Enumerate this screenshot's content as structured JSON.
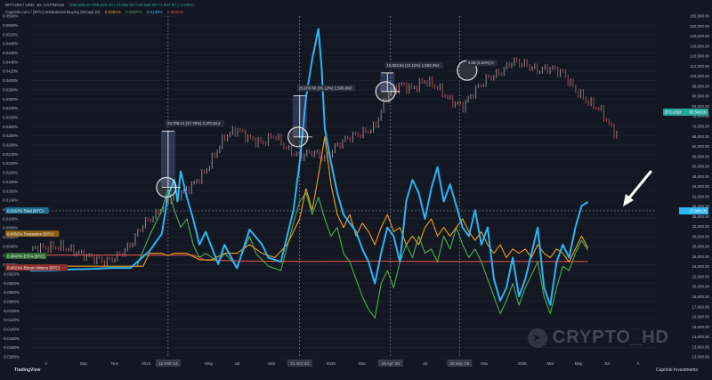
{
  "header": {
    "line1": "BITCOIN / USD, 1D, CAPRIOLE",
    "ohlc": "O95,568.00  H95,620.00  L78,052.00  C80,568.00  +1,007.57 (+2.58%)",
    "line2": "Capriole.com / (BTC) Institutional Buying (MCap) (0)",
    "ind_values": [
      "0.0052%",
      "0.0047%",
      "0.0138%",
      "0.0021%"
    ]
  },
  "watermark": "CRYPTO_HD",
  "branding": {
    "tradingview": "TradingView",
    "capriole": "Capriole Investments"
  },
  "colors": {
    "background": "#131722",
    "price_up": "#8a8c90",
    "price_down": "#a64a4f",
    "total": "#29b6f6",
    "treasuries": "#f2a01b",
    "etfs": "#4caf50",
    "miners": "#ef5350",
    "annotation": "#6f8bd6"
  },
  "chart_data": {
    "type": "line",
    "title": "",
    "x_ticks": [
      "2",
      "Sep",
      "Nov",
      "2024",
      "12 Feb '24",
      "May",
      "Jul",
      "Sep",
      "21 Oct '24",
      "2025",
      "Mar",
      "26 Apr '25",
      "Jul",
      "30 Sep '25",
      "Nov",
      "2026",
      "Mar",
      "May",
      "Jul",
      "A"
    ],
    "x_tick_frac": [
      0.025,
      0.085,
      0.135,
      0.185,
      0.22,
      0.285,
      0.33,
      0.385,
      0.43,
      0.48,
      0.53,
      0.575,
      0.63,
      0.685,
      0.725,
      0.785,
      0.83,
      0.875,
      0.92,
      0.97
    ],
    "left_axis": [
      "0.0590%",
      "0.0560%",
      "0.0520%",
      "0.0480%",
      "0.0460%",
      "0.0440%",
      "0.0420%",
      "0.0400%",
      "0.0380%",
      "0.0360%",
      "0.0340%",
      "0.0320%",
      "0.0300%",
      "0.0280%",
      "0.0260%",
      "0.0240%",
      "0.0220%",
      "0.0200%",
      "0.0180%",
      "0.0160%",
      "0.0140%",
      "0.0120%",
      "0.0100%",
      "0.0080%",
      "0.0060%",
      "0.0040%",
      "0.0020%",
      "0.0000%",
      "-0.0020%",
      "-0.0040%",
      "-0.0060%",
      "-0.0080%",
      "-0.0100%",
      "-0.0120%",
      "-0.0140%",
      "-0.0160%",
      "-0.0180%",
      "-0.0200%"
    ],
    "left_range": [
      -0.02,
      0.059
    ],
    "right_axis": [
      "165,000.00",
      "150,000.00",
      "140,000.00",
      "130,000.00",
      "120,000.00",
      "112,000.00",
      "104,000.00",
      "98,000.00",
      "90,000.00",
      "84,000.00",
      "76,000.00",
      "72,000.00",
      "68,000.00",
      "62,000.00",
      "56,000.00",
      "52,000.00",
      "48,000.00",
      "44,000.00",
      "41,000.00",
      "38,000.00",
      "35,000.00",
      "32,000.00",
      "30,000.00",
      "28,000.00",
      "26,000.00",
      "24,000.00",
      "22,000.00",
      "20,000.00",
      "18,600.00",
      "17,600.00",
      "16,600.00",
      "15,600.00",
      "14,800.00",
      "13,800.00",
      "13,000.00"
    ],
    "price_scale": "log",
    "price_range": [
      13000,
      165000
    ],
    "price": [
      [
        0.0,
        29000
      ],
      [
        0.02,
        29300
      ],
      [
        0.05,
        29600
      ],
      [
        0.08,
        28000
      ],
      [
        0.1,
        27200
      ],
      [
        0.12,
        26400
      ],
      [
        0.14,
        27500
      ],
      [
        0.16,
        30000
      ],
      [
        0.18,
        35000
      ],
      [
        0.2,
        37500
      ],
      [
        0.22,
        42000
      ],
      [
        0.24,
        44000
      ],
      [
        0.26,
        47000
      ],
      [
        0.28,
        52000
      ],
      [
        0.31,
        67000
      ],
      [
        0.33,
        71000
      ],
      [
        0.35,
        66000
      ],
      [
        0.37,
        64000
      ],
      [
        0.39,
        68000
      ],
      [
        0.41,
        61000
      ],
      [
        0.43,
        58000
      ],
      [
        0.45,
        60000
      ],
      [
        0.47,
        57000
      ],
      [
        0.49,
        63000
      ],
      [
        0.51,
        67000
      ],
      [
        0.53,
        69000
      ],
      [
        0.55,
        72000
      ],
      [
        0.57,
        92000
      ],
      [
        0.59,
        99000
      ],
      [
        0.61,
        96000
      ],
      [
        0.63,
        102000
      ],
      [
        0.65,
        97000
      ],
      [
        0.67,
        88000
      ],
      [
        0.69,
        84000
      ],
      [
        0.71,
        95000
      ],
      [
        0.73,
        104000
      ],
      [
        0.75,
        108000
      ],
      [
        0.77,
        118000
      ],
      [
        0.79,
        115000
      ],
      [
        0.81,
        110000
      ],
      [
        0.83,
        112000
      ],
      [
        0.85,
        108000
      ],
      [
        0.87,
        95000
      ],
      [
        0.89,
        87000
      ],
      [
        0.91,
        82000
      ],
      [
        0.93,
        70000
      ],
      [
        0.95,
        66000
      ],
      [
        0.97,
        72000
      ],
      [
        1.0,
        80500
      ]
    ],
    "series": [
      {
        "name": "Total (BTC)",
        "value_label": "0.0157%",
        "points": [
          [
            0.0,
            0.0
          ],
          [
            0.04,
            0.0001
          ],
          [
            0.07,
            0.0003
          ],
          [
            0.1,
            0.0004
          ],
          [
            0.13,
            0.0006
          ],
          [
            0.16,
            0.0006
          ],
          [
            0.19,
            0.0045
          ],
          [
            0.21,
            0.0085
          ],
          [
            0.22,
            0.0175
          ],
          [
            0.23,
            0.021
          ],
          [
            0.235,
            0.016
          ],
          [
            0.24,
            0.023
          ],
          [
            0.25,
            0.017
          ],
          [
            0.26,
            0.012
          ],
          [
            0.27,
            0.006
          ],
          [
            0.28,
            0.009
          ],
          [
            0.3,
            0.0015
          ],
          [
            0.31,
            0.006
          ],
          [
            0.33,
            0.0005
          ],
          [
            0.35,
            0.0095
          ],
          [
            0.37,
            0.006
          ],
          [
            0.38,
            0.003
          ],
          [
            0.4,
            0.002
          ],
          [
            0.42,
            0.014
          ],
          [
            0.43,
            0.025
          ],
          [
            0.44,
            0.04
          ],
          [
            0.45,
            0.049
          ],
          [
            0.46,
            0.056
          ],
          [
            0.465,
            0.047
          ],
          [
            0.47,
            0.033
          ],
          [
            0.48,
            0.025
          ],
          [
            0.49,
            0.018
          ],
          [
            0.5,
            0.013
          ],
          [
            0.51,
            0.011
          ],
          [
            0.52,
            0.009
          ],
          [
            0.53,
            0.005
          ],
          [
            0.54,
            0.002
          ],
          [
            0.55,
            -0.003
          ],
          [
            0.56,
            0.004
          ],
          [
            0.57,
            0.01
          ],
          [
            0.58,
            0.008
          ],
          [
            0.59,
            0.002
          ],
          [
            0.6,
            0.016
          ],
          [
            0.61,
            0.021
          ],
          [
            0.62,
            0.018
          ],
          [
            0.63,
            0.012
          ],
          [
            0.64,
            0.019
          ],
          [
            0.65,
            0.024
          ],
          [
            0.66,
            0.016
          ],
          [
            0.67,
            0.02
          ],
          [
            0.68,
            0.015
          ],
          [
            0.69,
            0.01
          ],
          [
            0.7,
            0.008
          ],
          [
            0.71,
            0.014
          ],
          [
            0.72,
            0.006
          ],
          [
            0.73,
            0.01
          ],
          [
            0.74,
            -0.002
          ],
          [
            0.75,
            -0.007
          ],
          [
            0.76,
            -0.004
          ],
          [
            0.77,
            0.003
          ],
          [
            0.78,
            -0.006
          ],
          [
            0.79,
            -0.002
          ],
          [
            0.8,
            0.004
          ],
          [
            0.81,
            0.01
          ],
          [
            0.82,
            -0.004
          ],
          [
            0.83,
            -0.008
          ],
          [
            0.84,
            0.002
          ],
          [
            0.85,
            0.006
          ],
          [
            0.86,
            0.003
          ],
          [
            0.87,
            0.01
          ],
          [
            0.88,
            0.015
          ],
          [
            0.89,
            0.0159
          ]
        ]
      },
      {
        "name": "Treasuries (BTC)",
        "value_label": "0.0052%",
        "points": [
          [
            0.0,
            0.001
          ],
          [
            0.1,
            0.001
          ],
          [
            0.18,
            0.001
          ],
          [
            0.19,
            0.004
          ],
          [
            0.21,
            0.004
          ],
          [
            0.22,
            0.0035
          ],
          [
            0.23,
            0.004
          ],
          [
            0.25,
            0.004
          ],
          [
            0.27,
            0.0025
          ],
          [
            0.29,
            0.0025
          ],
          [
            0.31,
            0.004
          ],
          [
            0.33,
            0.004
          ],
          [
            0.35,
            0.006
          ],
          [
            0.37,
            0.004
          ],
          [
            0.39,
            0.003
          ],
          [
            0.41,
            0.006
          ],
          [
            0.43,
            0.012
          ],
          [
            0.44,
            0.019
          ],
          [
            0.45,
            0.014
          ],
          [
            0.46,
            0.022
          ],
          [
            0.47,
            0.031
          ],
          [
            0.48,
            0.02
          ],
          [
            0.49,
            0.013
          ],
          [
            0.5,
            0.01
          ],
          [
            0.51,
            0.013
          ],
          [
            0.52,
            0.008
          ],
          [
            0.53,
            0.011
          ],
          [
            0.54,
            0.009
          ],
          [
            0.55,
            0.006
          ],
          [
            0.56,
            0.01
          ],
          [
            0.57,
            0.013
          ],
          [
            0.58,
            0.009
          ],
          [
            0.59,
            0.01
          ],
          [
            0.6,
            0.006
          ],
          [
            0.61,
            0.008
          ],
          [
            0.62,
            0.006
          ],
          [
            0.63,
            0.01
          ],
          [
            0.64,
            0.012
          ],
          [
            0.65,
            0.008
          ],
          [
            0.66,
            0.01
          ],
          [
            0.67,
            0.008
          ],
          [
            0.68,
            0.01
          ],
          [
            0.69,
            0.012
          ],
          [
            0.7,
            0.009
          ],
          [
            0.71,
            0.007
          ],
          [
            0.72,
            0.009
          ],
          [
            0.73,
            0.006
          ],
          [
            0.74,
            0.004
          ],
          [
            0.75,
            0.006
          ],
          [
            0.76,
            0.003
          ],
          [
            0.77,
            0.005
          ],
          [
            0.78,
            0.004
          ],
          [
            0.79,
            0.005
          ],
          [
            0.8,
            0.003
          ],
          [
            0.81,
            0.006
          ],
          [
            0.82,
            0.004
          ],
          [
            0.83,
            0.003
          ],
          [
            0.84,
            0.005
          ],
          [
            0.85,
            0.004
          ],
          [
            0.86,
            0.002
          ],
          [
            0.87,
            0.005
          ],
          [
            0.88,
            0.008
          ],
          [
            0.89,
            0.0052
          ]
        ]
      },
      {
        "name": "ETFs (BTC)",
        "value_label": "0.0047%",
        "points": [
          [
            0.17,
            0.001
          ],
          [
            0.19,
            0.008
          ],
          [
            0.21,
            0.014
          ],
          [
            0.22,
            0.019
          ],
          [
            0.23,
            0.014
          ],
          [
            0.24,
            0.01
          ],
          [
            0.25,
            0.012
          ],
          [
            0.26,
            0.006
          ],
          [
            0.27,
            0.003
          ],
          [
            0.28,
            0.004
          ],
          [
            0.3,
            0.002
          ],
          [
            0.31,
            0.004
          ],
          [
            0.33,
            0.001
          ],
          [
            0.35,
            0.008
          ],
          [
            0.36,
            0.004
          ],
          [
            0.38,
            0.001
          ],
          [
            0.4,
            0.0
          ],
          [
            0.42,
            0.011
          ],
          [
            0.43,
            0.016
          ],
          [
            0.44,
            0.018
          ],
          [
            0.45,
            0.013
          ],
          [
            0.46,
            0.017
          ],
          [
            0.47,
            0.012
          ],
          [
            0.48,
            0.008
          ],
          [
            0.49,
            0.01
          ],
          [
            0.5,
            0.004
          ],
          [
            0.51,
            0.002
          ],
          [
            0.52,
            -0.002
          ],
          [
            0.53,
            -0.006
          ],
          [
            0.54,
            -0.009
          ],
          [
            0.55,
            -0.011
          ],
          [
            0.56,
            -0.003
          ],
          [
            0.57,
            0.0
          ],
          [
            0.58,
            -0.004
          ],
          [
            0.59,
            0.002
          ],
          [
            0.6,
            0.006
          ],
          [
            0.61,
            0.003
          ],
          [
            0.62,
            0.008
          ],
          [
            0.63,
            0.004
          ],
          [
            0.64,
            0.005
          ],
          [
            0.65,
            0.002
          ],
          [
            0.66,
            0.008
          ],
          [
            0.67,
            0.005
          ],
          [
            0.68,
            0.01
          ],
          [
            0.69,
            0.006
          ],
          [
            0.7,
            0.003
          ],
          [
            0.71,
            0.005
          ],
          [
            0.72,
            0.002
          ],
          [
            0.73,
            -0.002
          ],
          [
            0.74,
            -0.006
          ],
          [
            0.75,
            -0.01
          ],
          [
            0.76,
            -0.007
          ],
          [
            0.77,
            -0.003
          ],
          [
            0.78,
            -0.008
          ],
          [
            0.79,
            -0.004
          ],
          [
            0.8,
            -0.001
          ],
          [
            0.81,
            0.002
          ],
          [
            0.82,
            -0.006
          ],
          [
            0.83,
            -0.01
          ],
          [
            0.84,
            -0.004
          ],
          [
            0.85,
            0.001
          ],
          [
            0.86,
            0.0
          ],
          [
            0.87,
            0.004
          ],
          [
            0.88,
            0.007
          ],
          [
            0.89,
            0.0047
          ]
        ]
      },
      {
        "name": "Bitcoin Miners (BTC)",
        "value_label": "0.0021%",
        "points": [
          [
            0.0,
            0.0036
          ],
          [
            0.1,
            0.0036
          ],
          [
            0.2,
            0.0036
          ],
          [
            0.26,
            0.0036
          ],
          [
            0.28,
            0.0024
          ],
          [
            0.35,
            0.0022
          ],
          [
            0.45,
            0.0021
          ],
          [
            0.55,
            0.0022
          ],
          [
            0.65,
            0.0021
          ],
          [
            0.75,
            0.0021
          ],
          [
            0.85,
            0.0021
          ],
          [
            0.89,
            0.0021
          ]
        ]
      }
    ],
    "annotations": [
      {
        "label": "23,706.14 (47.79%) 2,370,614",
        "x": 0.22,
        "from": 46000,
        "to": 70000
      },
      {
        "label": "25,000.60 (36.12%) 2,500,060",
        "x": 0.43,
        "from": 67000,
        "to": 91000
      },
      {
        "label": "15,923.64 (10.11%) 1,592,364",
        "x": 0.57,
        "from": 94000,
        "to": 108000
      },
      {
        "label": "4.09 (0.00%) 0",
        "x": 0.7,
        "from": 110000,
        "to": 110000
      }
    ],
    "vlines": [
      0.22,
      0.43,
      0.575,
      0.685
    ],
    "price_tag": {
      "label": "BTCUSD",
      "value": "80,568.00"
    },
    "total_tag": {
      "value": "37,890.00"
    },
    "legend_labels": [
      "0.0157% Total (BTC)",
      "0.0052% Treasuries (BTC)",
      "0.0047% ETFs (BTC)",
      "0.0021% Bitcoin Miners (BTC)"
    ]
  }
}
